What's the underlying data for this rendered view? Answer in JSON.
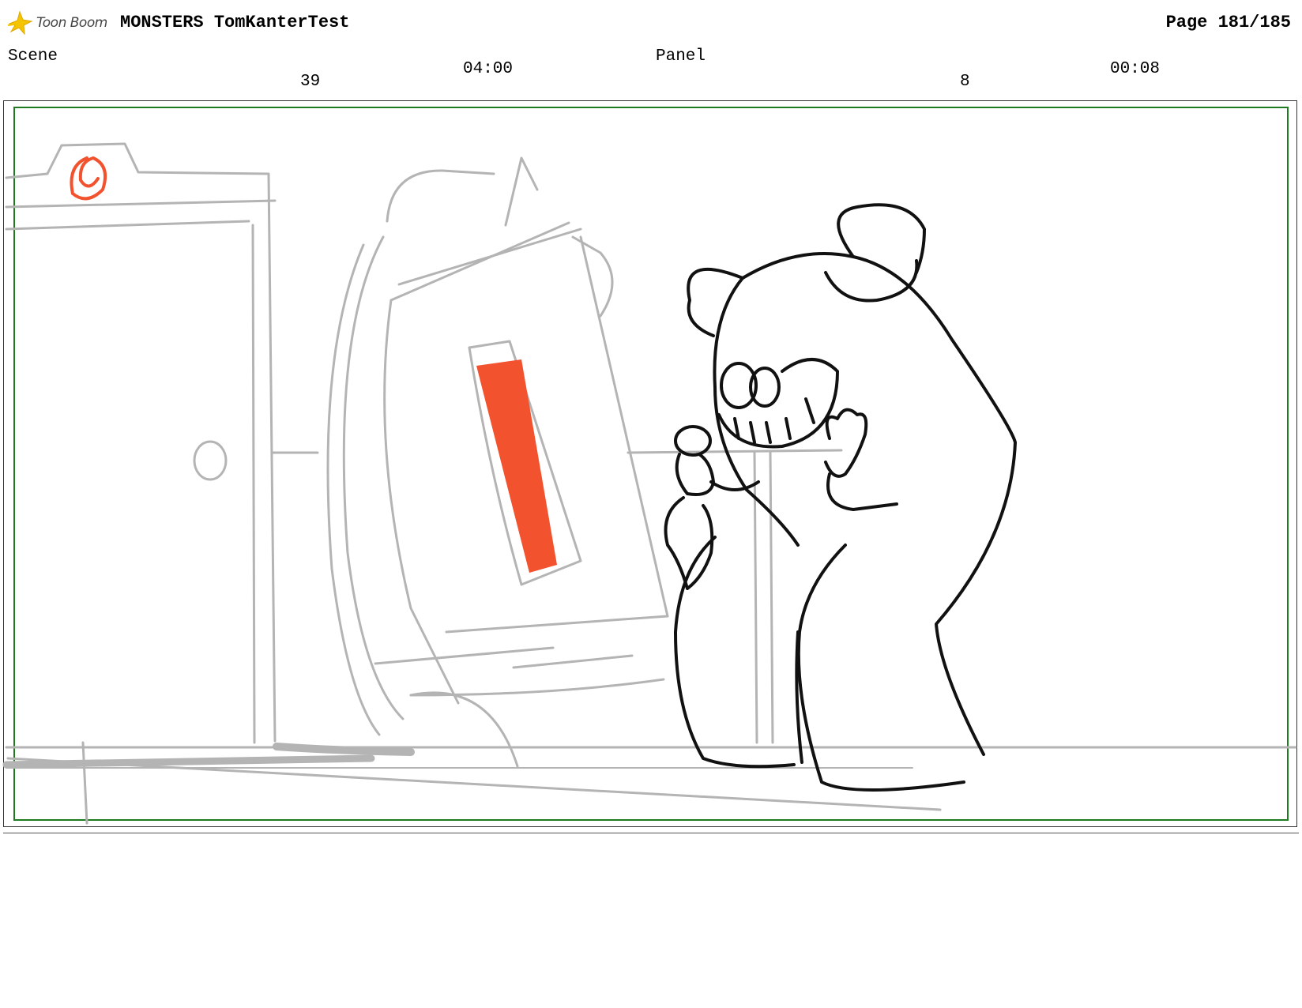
{
  "header": {
    "logo_text": "Toon Boom",
    "project_title": "MONSTERS TomKanterTest",
    "page_label": "Page 181/185"
  },
  "scene": {
    "label": "Scene",
    "number": "39",
    "duration": "04:00"
  },
  "panel": {
    "label": "Panel",
    "number": "8",
    "duration": "00:08"
  },
  "colors": {
    "safe_frame": "#1e7a1e",
    "sketch_gray": "#b4b4b4",
    "accent_red": "#f2522e",
    "ink": "#111111"
  },
  "icons": {
    "logo": "toon-boom-star-icon"
  }
}
